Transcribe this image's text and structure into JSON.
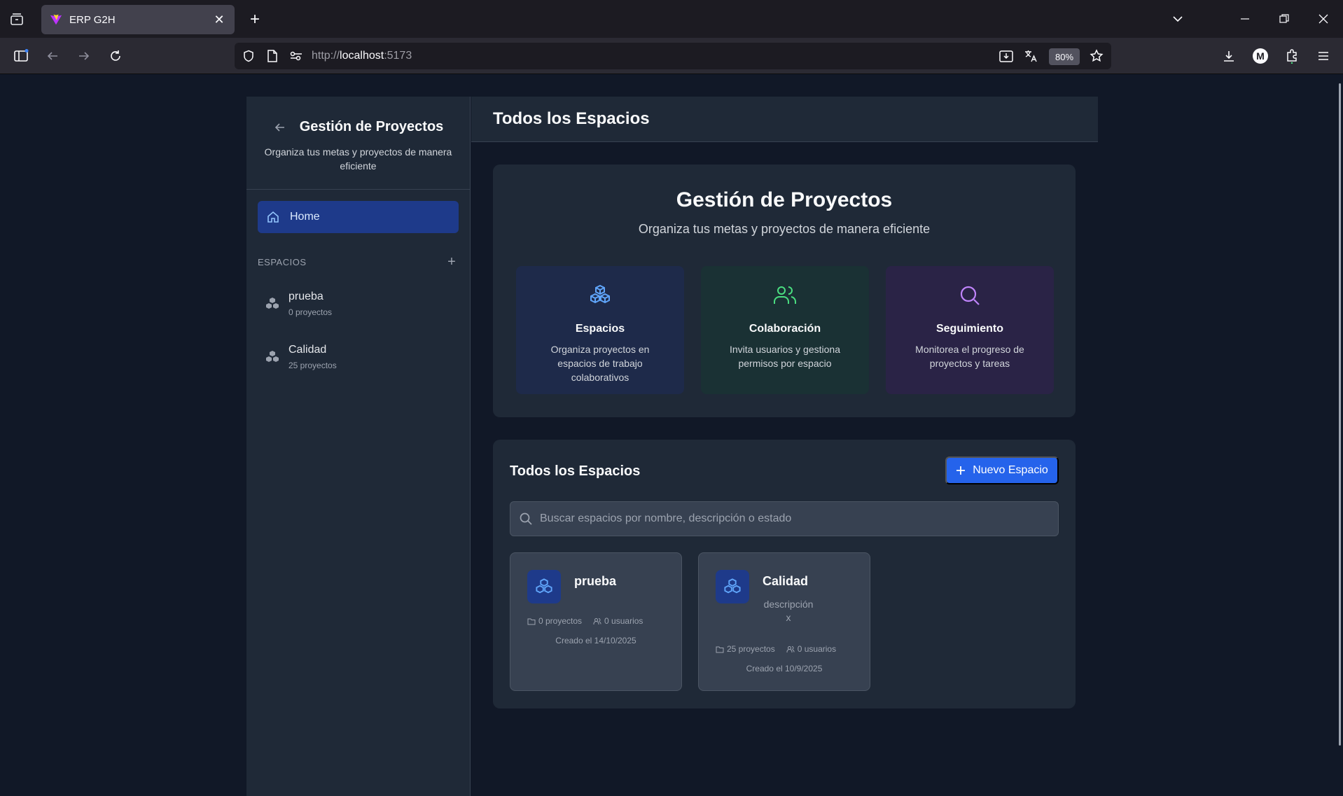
{
  "browser": {
    "tab_title": "ERP G2H",
    "url_scheme": "http://",
    "url_host": "localhost",
    "url_port": ":5173",
    "zoom": "80%"
  },
  "sidebar": {
    "title": "Gestión de Proyectos",
    "subtitle": "Organiza tus metas y proyectos de manera eficiente",
    "home_label": "Home",
    "section_label": "ESPACIOS",
    "spaces": [
      {
        "name": "prueba",
        "count": "0 proyectos"
      },
      {
        "name": "Calidad",
        "count": "25 proyectos"
      }
    ]
  },
  "main": {
    "header_title": "Todos los Espacios",
    "hero": {
      "title": "Gestión de Proyectos",
      "subtitle": "Organiza tus metas y proyectos de manera eficiente",
      "features": [
        {
          "title": "Espacios",
          "desc": "Organiza proyectos en espacios de trabajo colaborativos",
          "icon": "cubes-icon",
          "color": "#60a5fa",
          "bg": "#1e2a4a"
        },
        {
          "title": "Colaboración",
          "desc": "Invita usuarios y gestiona permisos por espacio",
          "icon": "users-icon",
          "color": "#4ade80",
          "bg": "#1a3134"
        },
        {
          "title": "Seguimiento",
          "desc": "Monitorea el progreso de proyectos y tareas",
          "icon": "search-icon",
          "color": "#c084fc",
          "bg": "#2a2346"
        }
      ]
    },
    "spaces_panel": {
      "title": "Todos los Espacios",
      "new_button": "Nuevo Espacio",
      "search_placeholder": "Buscar espacios por nombre, descripción o estado",
      "cards": [
        {
          "name": "prueba",
          "description": "",
          "projects": "0 proyectos",
          "users": "0 usuarios",
          "created": "Creado el 14/10/2025"
        },
        {
          "name": "Calidad",
          "description": "descripción x",
          "projects": "25 proyectos",
          "users": "0 usuarios",
          "created": "Creado el 10/9/2025"
        }
      ]
    }
  }
}
